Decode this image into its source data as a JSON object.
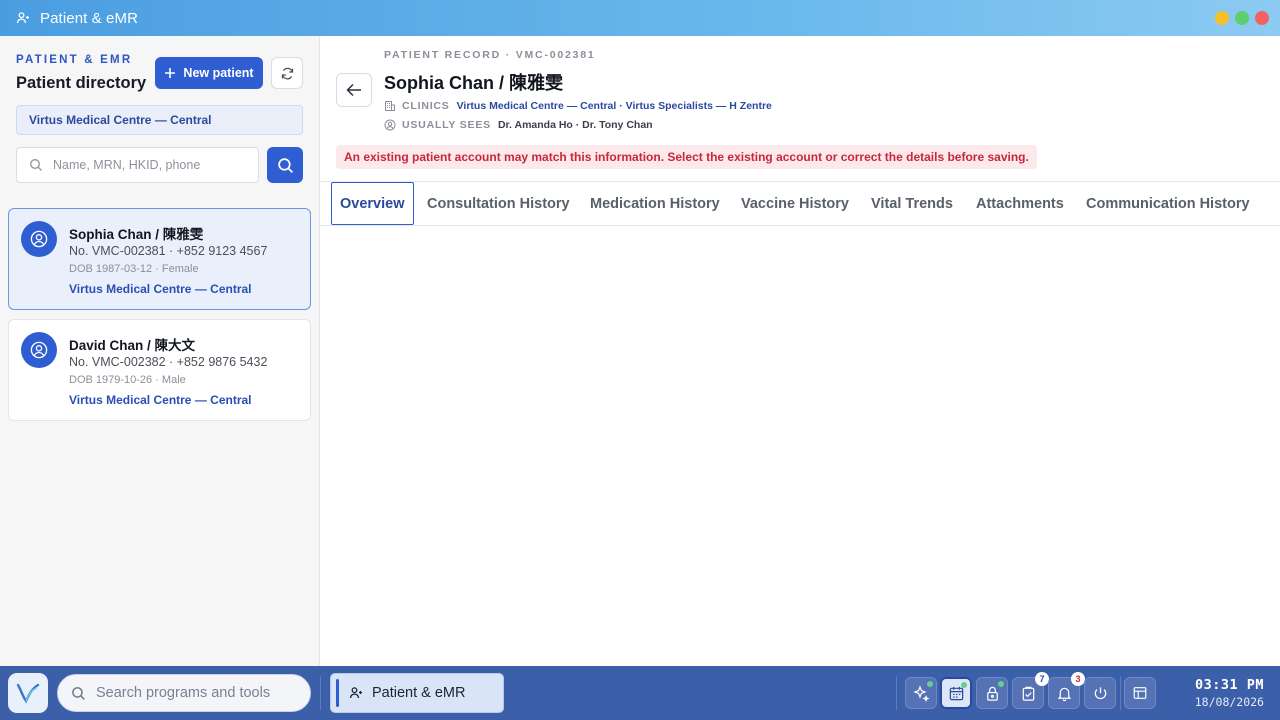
{
  "window": {
    "title": "Patient & eMR",
    "controls": {
      "minimize_color": "#f5c028",
      "maximize_color": "#5fcf6b",
      "close_color": "#f06360"
    }
  },
  "sidebar": {
    "eyebrow": "PATIENT & EMR",
    "title": "Patient directory",
    "new_patient_label": "New patient",
    "clinic_filter": "Virtus Medical Centre — Central",
    "search_placeholder": "Name, MRN, HKID, phone",
    "patients": [
      {
        "name": "Sophia Chan / 陳雅雯",
        "line": "No. VMC-002381 · +852 9123 4567",
        "dob": "DOB 1987-03-12 · Female",
        "clinic": "Virtus Medical Centre — Central",
        "selected": true
      },
      {
        "name": "David Chan / 陳大文",
        "line": "No. VMC-002382 · +852 9876 5432",
        "dob": "DOB 1979-10-26 · Male",
        "clinic": "Virtus Medical Centre — Central",
        "selected": false
      }
    ]
  },
  "record": {
    "eyebrow": "PATIENT RECORD · VMC-002381",
    "name": "Sophia Chan / 陳雅雯",
    "clinics_label": "CLINICS",
    "clinics_value": "Virtus Medical Centre — Central · Virtus Specialists — H Zentre",
    "usually_sees_label": "USUALLY SEES",
    "usually_sees_value": "Dr. Amanda Ho · Dr. Tony Chan",
    "warning": "An existing patient account may match this information. Select the existing account or correct the details before saving.",
    "tabs": [
      "Overview",
      "Consultation History",
      "Medication History",
      "Vaccine History",
      "Vital Trends",
      "Attachments",
      "Communication History"
    ],
    "active_tab": "Overview"
  },
  "taskbar": {
    "search_placeholder": "Search programs and tools",
    "running_app": "Patient & eMR",
    "tray": {
      "tasks_badge": "7",
      "notifications_badge": "3"
    },
    "clock": {
      "time": "03:31 PM",
      "date": "18/08/2026"
    }
  }
}
